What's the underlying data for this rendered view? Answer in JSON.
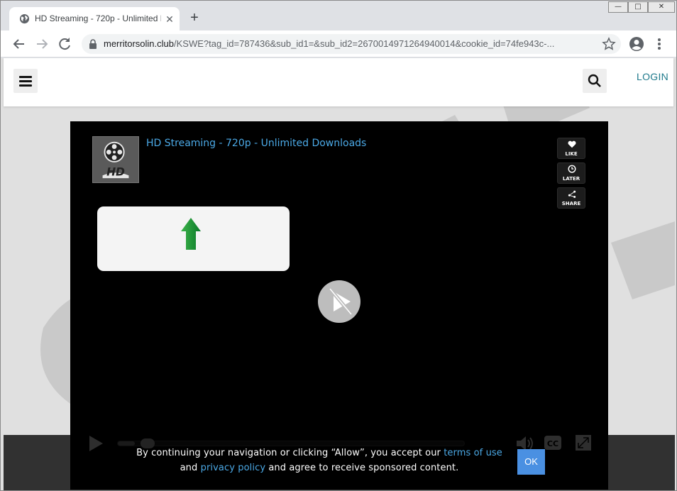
{
  "browser": {
    "tab_title": "HD Streaming - 720p - Unlimited Downloads",
    "tab_close": "✕",
    "new_tab": "+",
    "window_controls": {
      "minimize": "—",
      "maximize": "□",
      "close": "✕"
    },
    "url_host": "merritorsolin.club",
    "url_rest": "/KSWE?tag_id=787436&sub_id1=&sub_id2=2670014971264940014&cookie_id=74fe943c-...",
    "icons": [
      "back-arrow-icon",
      "forward-arrow-icon",
      "reload-icon",
      "lock-icon",
      "star-icon",
      "profile-icon",
      "kebab-menu-icon",
      "globe-icon"
    ]
  },
  "site": {
    "login_label": "LOGIN",
    "accent_color": "#1f7a8c"
  },
  "player": {
    "title": "HD Streaming - 720p - Unlimited Downloads",
    "thumb_label": "HD",
    "like_label": "LIKE",
    "later_label": "LATER",
    "share_label": "SHARE",
    "title_color": "#4ba9e6",
    "progress_fraction": 0.05
  },
  "consent": {
    "text_before": "By continuing your navigation or clicking “Allow”, you accept our",
    "terms_link": "terms of use",
    "text_and": "and",
    "privacy_link": "privacy policy",
    "text_after": "and agree to receive sponsored content.",
    "ok_label": "OK",
    "button_color": "#4a90e2"
  }
}
